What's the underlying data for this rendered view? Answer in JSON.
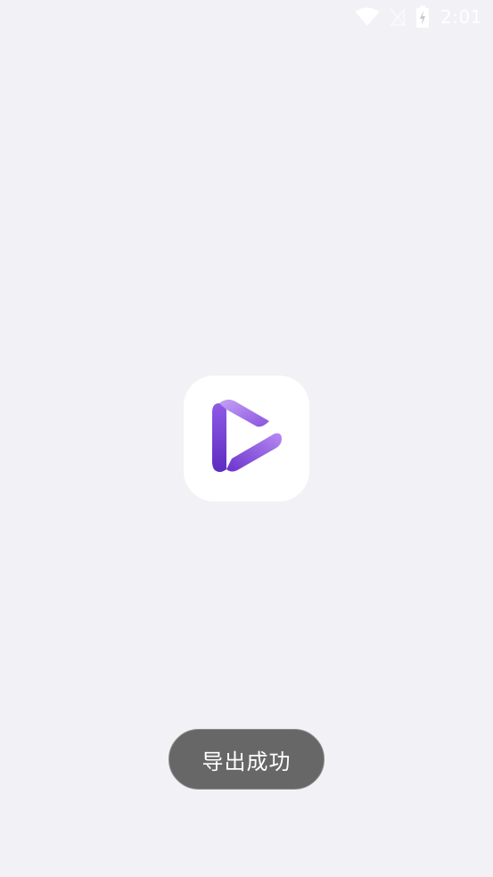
{
  "status_bar": {
    "time": "2:01",
    "icons": [
      "wifi-icon",
      "no-signal-icon",
      "battery-charging-icon"
    ],
    "icon_color": "#ffffff"
  },
  "app_icon": {
    "icon": "play-logo-icon",
    "colors": [
      "#b58cf0",
      "#7b3fd6",
      "#5a25b8"
    ]
  },
  "toast": {
    "message": "导出成功",
    "background": "#676767"
  },
  "background_color": "#f2f1f6"
}
